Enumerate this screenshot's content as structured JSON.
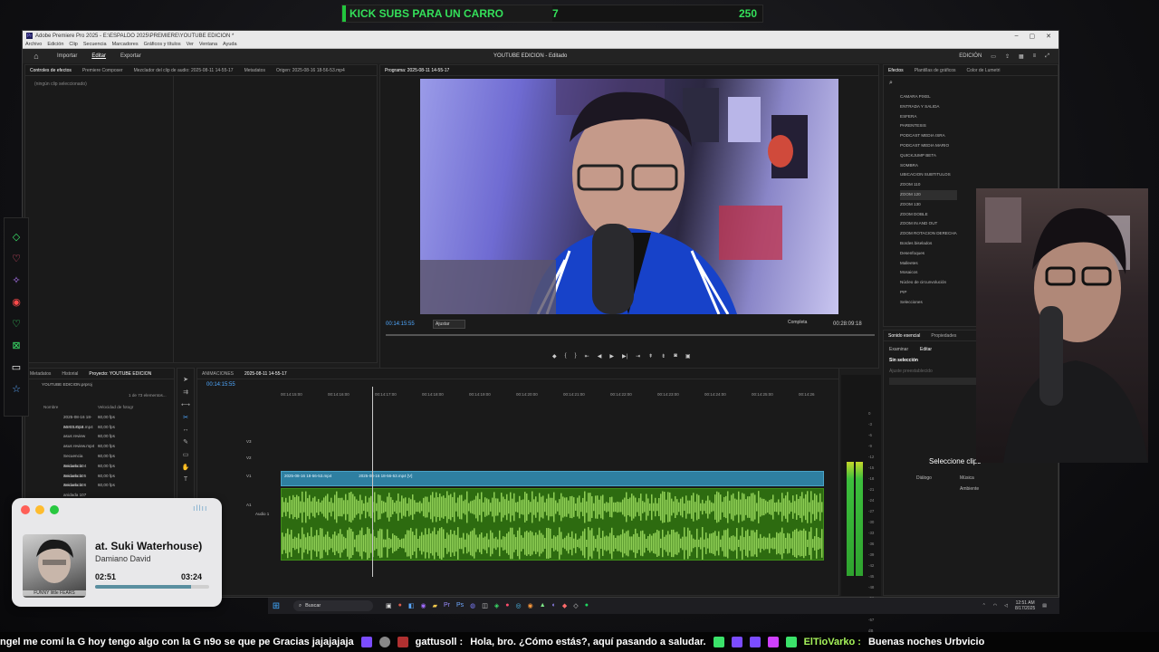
{
  "banner": {
    "title": "KICK SUBS PARA UN CARRO",
    "count": "7",
    "goal": "250"
  },
  "window": {
    "title": "Adobe Premiere Pro 2025 - E:\\ESPALDO 2025\\PREMIERE\\YOUTUBE EDICION *",
    "menu": [
      "Archivo",
      "Edición",
      "Clip",
      "Secuencia",
      "Marcadores",
      "Gráficos y títulos",
      "Ver",
      "Ventana",
      "Ayuda"
    ],
    "workspaces": [
      "Importar",
      "Editar",
      "Exportar"
    ],
    "project_title": "YOUTUBE EDICION - Editado",
    "edit_label": "EDICIÓN"
  },
  "fx_panel": {
    "tabs": [
      "Controles de efectos",
      "Premiere Composer",
      "Mezclador del clip de audio: 2025-08-11 14-55-17",
      "Metadatos",
      "Origen: 2025-08-16 18-56-53.mp4"
    ],
    "empty": "(ningún clip seleccionado)"
  },
  "program": {
    "tab": "Programa: 2025-08-11 14-55-17",
    "timecode": "00:14:15:55",
    "fit": "Ajustar",
    "quality": "Completa",
    "duration": "00:28:09:18"
  },
  "effects_panel": {
    "tabs": [
      "Efectos",
      "Plantillas de gráficos",
      "Color de Lumetri"
    ],
    "items": [
      "CAMARA PIXEL",
      "ENTRADA Y SALIDA",
      "ESFERA",
      "PARENTESIS",
      "PODCAST MEDIA ISRA",
      "PODCAST MEDIA MARIO",
      "QUICKJUMP BETA",
      "SOMBRA",
      "UBICACION SUBTITULOS",
      "ZOOM 110",
      "ZOOM 120",
      "ZOOM 130",
      "ZOOM DOBLE",
      "ZOOM IN AND OUT",
      "ZOOM ROTACION DERECHA",
      "Bordes biselados",
      "Desenfoques",
      "Malleetes",
      "Mosaicos",
      "Núcleo de circunvolución",
      "PIP",
      "Selecciones"
    ]
  },
  "sound_panel": {
    "tabs": [
      "Sonido esencial",
      "Propiedades"
    ],
    "subtabs": [
      "Examinar",
      "Editar"
    ],
    "no_selection": "Sin selección",
    "preset": "Ajuste preestablecido",
    "select_clips": "Seleccione clips",
    "dialog": "Diálogo",
    "music": "Música",
    "ambient": "Ambiente"
  },
  "project_panel": {
    "tabs": [
      "Metadatos",
      "Historial",
      "Proyecto: YOUTUBE EDICION"
    ],
    "file": "YOUTUBE EDICION.prproj",
    "count": "1 de 73 elementos...",
    "cols": [
      "Nombre",
      "Velocidad de fotogr"
    ],
    "rows": [
      {
        "name": "2025-08-16 18-56-53.mp4",
        "fps": "60,00 fps"
      },
      {
        "name": "ASUS G18.mp4",
        "fps": "60,00 fps"
      },
      {
        "name": "asus review",
        "fps": "60,00 fps"
      },
      {
        "name": "asus review.mp4",
        "fps": "60,00 fps"
      },
      {
        "name": "Secuencia anidada 104",
        "fps": "60,00 fps"
      },
      {
        "name": "Secuencia anidada 105",
        "fps": "60,00 fps"
      },
      {
        "name": "Secuencia anidada 106",
        "fps": "60,00 fps"
      },
      {
        "name": "Secuencia anidada 107",
        "fps": "60,00 fps"
      }
    ]
  },
  "timeline": {
    "tabs": [
      "ANIMACIONES",
      "2025-08-11 14-55-17"
    ],
    "timecode": "00:14:15:55",
    "ruler": [
      "00:14:15:00",
      "00:14:16:00",
      "00:14:17:00",
      "00:14:18:00",
      "00:14:19:00",
      "00:14:20:00",
      "00:14:21:00",
      "00:14:22:00",
      "00:14:23:00",
      "00:14:24:00",
      "00:14:25:00",
      "00:14:26"
    ],
    "tracks": [
      "V3",
      "V2",
      "V1",
      "A1",
      "Audio 1"
    ],
    "clip_a": "2025-08-16 18-56-53.mp4",
    "clip_b": "2025-08-16 18-56-53.mp4 [V]"
  },
  "meter_scale": [
    "0",
    "-3",
    "-6",
    "-9",
    "-12",
    "-15",
    "-18",
    "-21",
    "-24",
    "-27",
    "-30",
    "-33",
    "-36",
    "-39",
    "-42",
    "-45",
    "-48",
    "-51",
    "-54",
    "-57",
    "dB"
  ],
  "music_widget": {
    "song": "at. Suki Waterhouse)",
    "artist": "Damiano David",
    "elapsed": "02:51",
    "total": "03:24",
    "progress": 0.84,
    "album_caption": "FUNNY little FEARS"
  },
  "taskbar": {
    "search": "Buscar",
    "time": "12:51 AM",
    "date": "8/17/2025"
  },
  "ticker": [
    {
      "user": "",
      "text": "ngel  me comí la G  hoy tengo algo con la G n9o se que pe  Gracias jajajajaja"
    },
    {
      "user": "gattusoll :",
      "text": "Hola, bro. ¿Cómo estás?, aquí pasando a saludar."
    },
    {
      "user": "ElTioVarko :",
      "text": "Buenas noches Urbvicio"
    }
  ],
  "colors": {
    "accent_green": "#34e05a",
    "timeline_video": "#2e7fa1",
    "timeline_audio": "#2d6b10",
    "playhead_blue": "#4fa8ff"
  }
}
